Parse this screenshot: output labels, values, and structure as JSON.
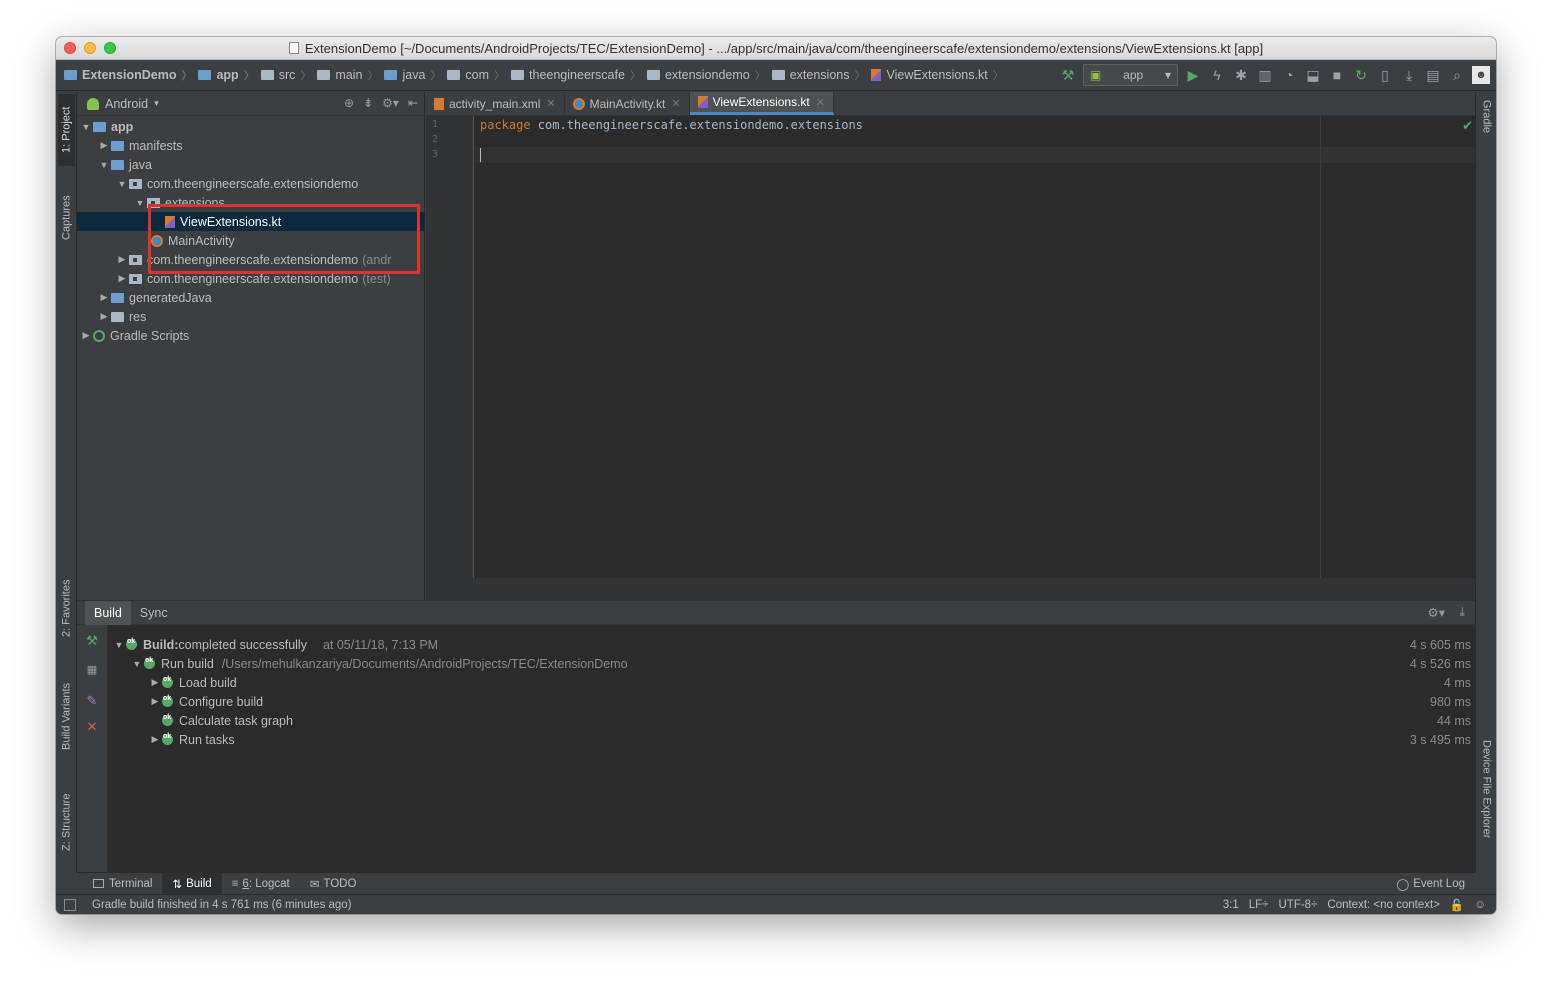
{
  "window": {
    "title": "ExtensionDemo [~/Documents/AndroidProjects/TEC/ExtensionDemo] - .../app/src/main/java/com/theengineerscafe/extensiondemo/extensions/ViewExtensions.kt [app]"
  },
  "breadcrumbs": [
    "ExtensionDemo",
    "app",
    "src",
    "main",
    "java",
    "com",
    "theengineerscafe",
    "extensiondemo",
    "extensions",
    "ViewExtensions.kt"
  ],
  "toolbar": {
    "run_config": "app"
  },
  "left_strip": {
    "project": "1: Project",
    "captures": "Captures",
    "favorites": "2: Favorites",
    "build_variants": "Build Variants",
    "structure": "Z: Structure"
  },
  "right_strip": {
    "gradle": "Gradle",
    "device_file_explorer": "Device File Explorer"
  },
  "project_panel": {
    "view": "Android",
    "tree": [
      {
        "label": "app",
        "depth": 0,
        "expanded": true
      },
      {
        "label": "manifests",
        "depth": 1,
        "expanded": false
      },
      {
        "label": "java",
        "depth": 1,
        "expanded": true
      },
      {
        "label": "com.theengineerscafe.extensiondemo",
        "depth": 2,
        "expanded": true
      },
      {
        "label": "extensions",
        "depth": 3,
        "expanded": true
      },
      {
        "label": "ViewExtensions.kt",
        "depth": 4
      },
      {
        "label": "MainActivity",
        "depth": 3
      },
      {
        "label": "com.theengineerscafe.extensiondemo",
        "suffix": "(andr",
        "depth": 2,
        "expanded": false
      },
      {
        "label": "com.theengineerscafe.extensiondemo",
        "suffix": "(test)",
        "depth": 2,
        "expanded": false
      },
      {
        "label": "generatedJava",
        "depth": 1,
        "expanded": false
      },
      {
        "label": "res",
        "depth": 1,
        "expanded": false
      },
      {
        "label": "Gradle Scripts",
        "depth": 0,
        "expanded": false
      }
    ]
  },
  "editor": {
    "tabs": [
      {
        "label": "activity_main.xml"
      },
      {
        "label": "MainActivity.kt"
      },
      {
        "label": "ViewExtensions.kt",
        "active": true
      }
    ],
    "line_numbers": [
      "1",
      "2",
      "3"
    ],
    "code": {
      "keyword": "package",
      "package_name": " com.theengineerscafe.extensiondemo.extensions"
    }
  },
  "build_panel": {
    "tabs": [
      "Build",
      "Sync"
    ],
    "rows": [
      {
        "label": "Build:",
        "label_rest": " completed successfully",
        "extra": "at 05/11/18, 7:13 PM",
        "time": "4 s 605 ms"
      },
      {
        "label": "Run build",
        "path": "/Users/mehulkanzariya/Documents/AndroidProjects/TEC/ExtensionDemo",
        "time": "4 s 526 ms"
      },
      {
        "label": "Load build",
        "time": "4 ms"
      },
      {
        "label": "Configure build",
        "time": "980 ms"
      },
      {
        "label": "Calculate task graph",
        "time": "44 ms"
      },
      {
        "label": "Run tasks",
        "time": "3 s 495 ms"
      }
    ]
  },
  "bottom_tabs": {
    "terminal": "Terminal",
    "build": "Build",
    "logcat_num": "6",
    "logcat": ": Logcat",
    "todo": "TODO",
    "event_log": "Event Log"
  },
  "status_bar": {
    "message": "Gradle build finished in 4 s 761 ms (6 minutes ago)",
    "position": "3:1",
    "line_sep": "LF÷",
    "encoding": "UTF-8÷",
    "context": "Context: <no context>"
  },
  "colors": {
    "accent": "#4a88c7",
    "highlight": "#e0302a",
    "success": "#59a869",
    "keyword": "#cc7832"
  }
}
